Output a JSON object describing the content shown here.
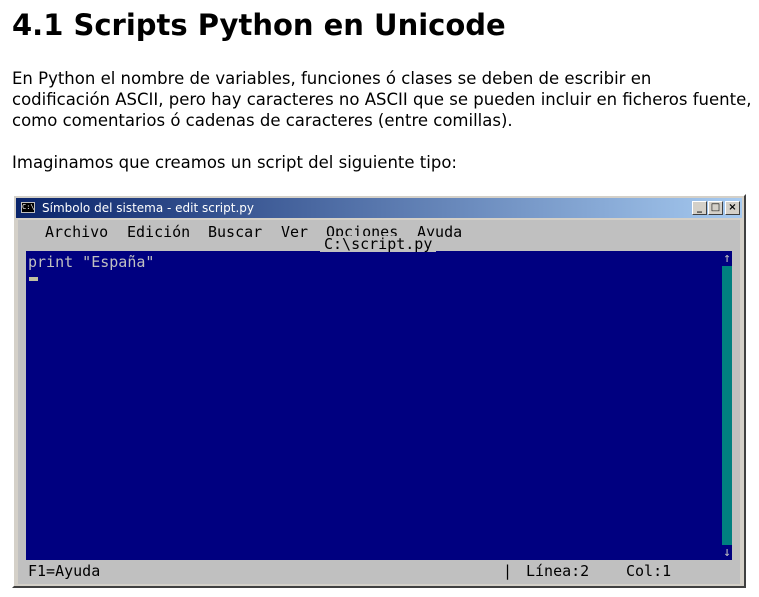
{
  "heading": "4.1 Scripts Python en Unicode",
  "paragraph1": "En Python el nombre de variables, funciones ó clases se deben de escribir en codificación ASCII, pero hay caracteres no ASCII que se pueden incluir en ficheros fuente, como comentarios ó cadenas de caracteres (entre comillas).",
  "paragraph2": "Imaginamos que creamos un script del siguiente tipo:",
  "window": {
    "title": "Símbolo del sistema - edit script.py",
    "icon": "cmd-icon",
    "minimize": "_",
    "maximize": "□",
    "close": "×"
  },
  "menu": {
    "archivo": "Archivo",
    "edicion": "Edición",
    "buscar": "Buscar",
    "ver": "Ver",
    "opciones": "Opciones",
    "ayuda": "Ayuda"
  },
  "editor": {
    "filename": "C:\\script.py",
    "code": "print \"España\"",
    "scroll_up": "↑",
    "scroll_down": "↓"
  },
  "status": {
    "help": "F1=Ayuda",
    "separator": "|",
    "line": "Línea:2",
    "col": "Col:1"
  },
  "colors": {
    "editor_background": "#000080",
    "console_gray": "#c0c0c0",
    "titlebar_start": "#0a246a",
    "titlebar_end": "#a6caf0"
  }
}
